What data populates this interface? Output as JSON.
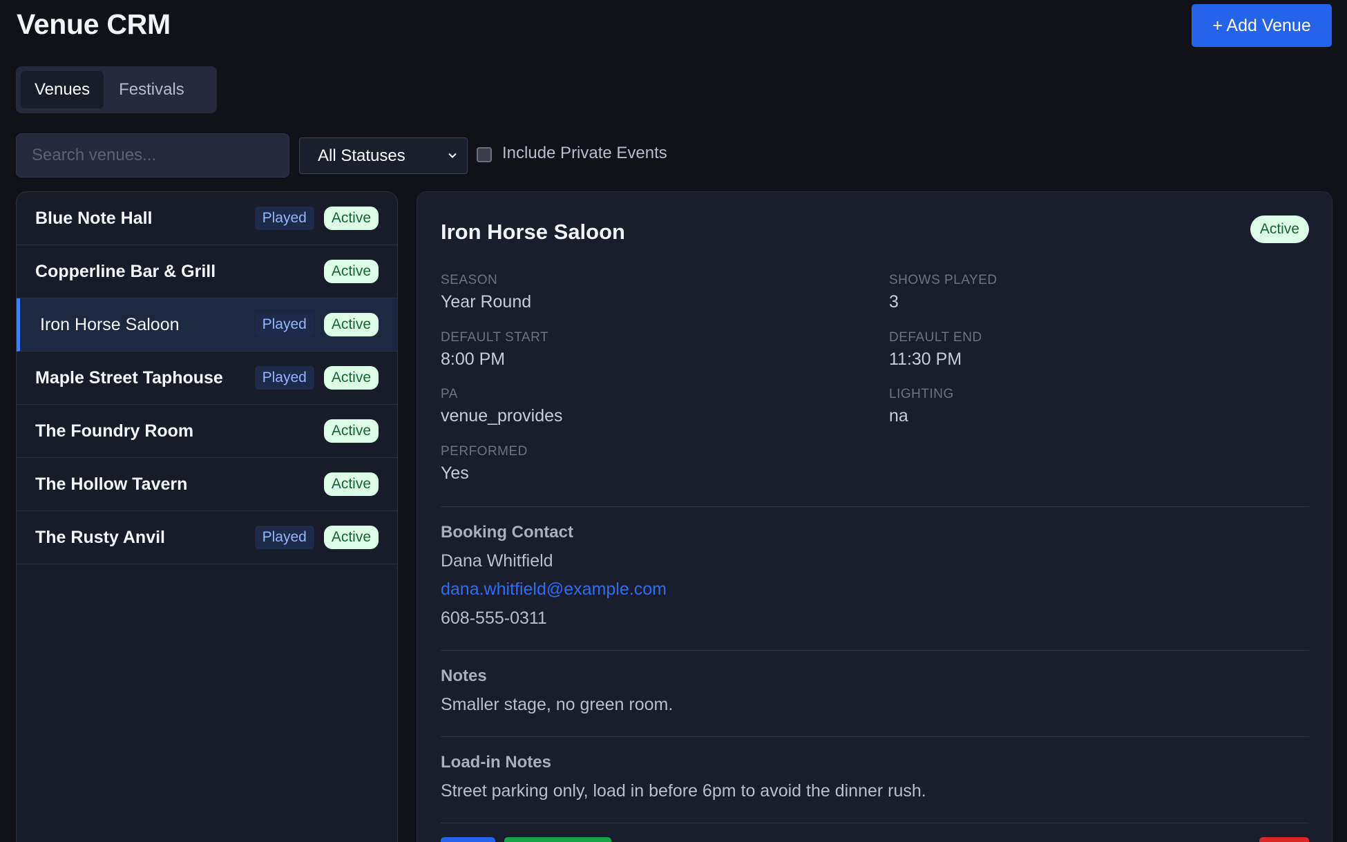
{
  "header": {
    "title": "Venue CRM",
    "add_button": "+ Add Venue"
  },
  "tabs": [
    {
      "label": "Venues",
      "active": true
    },
    {
      "label": "Festivals",
      "active": false
    }
  ],
  "filters": {
    "search_placeholder": "Search venues...",
    "search_value": "",
    "status_selected": "All Statuses",
    "include_private_label": "Include Private Events",
    "include_private_checked": false
  },
  "venues": [
    {
      "name": "Blue Note Hall",
      "played": "Played",
      "status": "Active"
    },
    {
      "name": "Copperline Bar & Grill",
      "played": "",
      "status": "Active"
    },
    {
      "name": "Iron Horse Saloon",
      "played": "Played",
      "status": "Active",
      "selected": true
    },
    {
      "name": "Maple Street Taphouse",
      "played": "Played",
      "status": "Active"
    },
    {
      "name": "The Foundry Room",
      "played": "",
      "status": "Active"
    },
    {
      "name": "The Hollow Tavern",
      "played": "",
      "status": "Active"
    },
    {
      "name": "The Rusty Anvil",
      "played": "Played",
      "status": "Active"
    }
  ],
  "detail": {
    "title": "Iron Horse Saloon",
    "status": "Active",
    "fields": {
      "season": {
        "label": "SEASON",
        "value": "Year Round"
      },
      "shows_played": {
        "label": "SHOWS PLAYED",
        "value": "3"
      },
      "default_start": {
        "label": "DEFAULT START",
        "value": "8:00 PM"
      },
      "default_end": {
        "label": "DEFAULT END",
        "value": "11:30 PM"
      },
      "pa": {
        "label": "PA",
        "value": "venue_provides"
      },
      "lighting": {
        "label": "LIGHTING",
        "value": "na"
      },
      "performed": {
        "label": "PERFORMED",
        "value": "Yes"
      }
    },
    "booking_contact": {
      "heading": "Booking Contact",
      "name": "Dana Whitfield",
      "email": "dana.whitfield@example.com",
      "phone": "608-555-0311"
    },
    "notes": {
      "heading": "Notes",
      "text": "Smaller stage, no green room."
    },
    "load_in": {
      "heading": "Load-in Notes",
      "text": "Street parking only, load in before 6pm to avoid the dinner rush."
    }
  },
  "colors": {
    "background": "#111218",
    "panel": "#1a1d2b",
    "primary": "#2563eb",
    "active_badge_bg": "#dcfce7",
    "active_badge_text": "#166534",
    "played_badge_bg": "#1e2a4a",
    "played_badge_text": "#93b4ff",
    "selected_accent": "#3b82f6",
    "danger": "#dc2626",
    "success": "#16a34a"
  }
}
